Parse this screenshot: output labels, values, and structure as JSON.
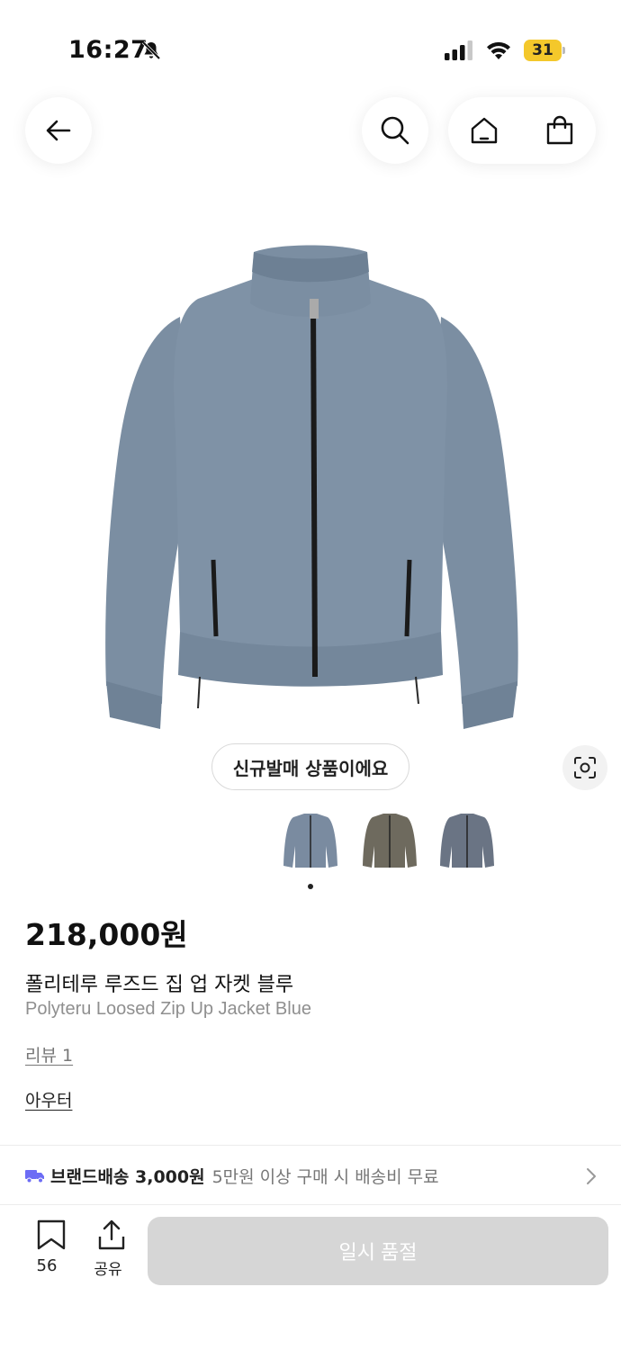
{
  "status_bar": {
    "time": "16:27",
    "battery": "31"
  },
  "nav": {
    "back": "back-arrow-icon",
    "search": "search-icon",
    "home": "home-icon",
    "cart": "shopping-bag-icon"
  },
  "product": {
    "color": "#7a8da0",
    "new_badge": "신규발매 상품이에요",
    "thumbnails": [
      {
        "color": "#7a8ba0"
      },
      {
        "color": "#6e6a5e"
      },
      {
        "color": "#6a7484"
      }
    ],
    "price": "218,000원",
    "name_ko": "폴리테루 루즈드 집 업 자켓 블루",
    "name_en": "Polyteru Loosed Zip Up Jacket Blue",
    "review": "리뷰 1",
    "category": "아우터"
  },
  "shipping": {
    "main": "브랜드배송 3,000원",
    "sub": "5만원 이상 구매 시 배송비 무료",
    "icon_color": "#6c6cf5"
  },
  "bottom_bar": {
    "bookmark_count": "56",
    "share_label": "공유",
    "soldout_label": "일시 품절"
  }
}
